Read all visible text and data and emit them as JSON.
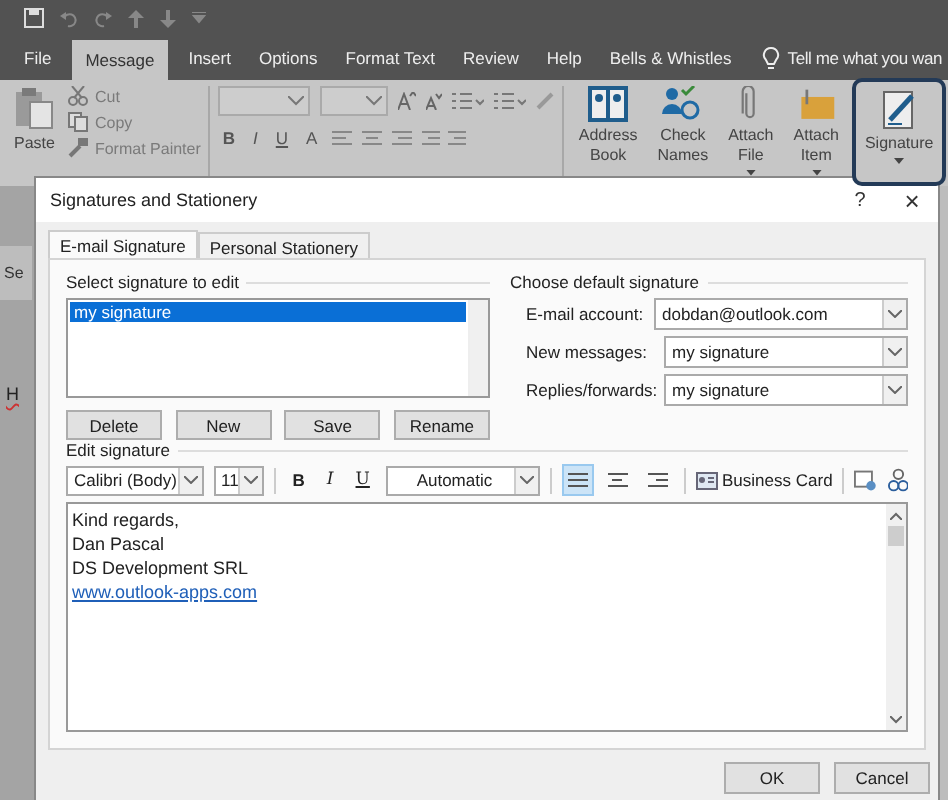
{
  "ribbon_tabs": [
    {
      "label": "File",
      "selected": false
    },
    {
      "label": "Message",
      "selected": true
    },
    {
      "label": "Insert",
      "selected": false
    },
    {
      "label": "Options",
      "selected": false
    },
    {
      "label": "Format Text",
      "selected": false
    },
    {
      "label": "Review",
      "selected": false
    },
    {
      "label": "Help",
      "selected": false
    },
    {
      "label": "Bells & Whistles",
      "selected": false
    }
  ],
  "tell_me": {
    "placeholder": "Tell me what you wan"
  },
  "clipboard": {
    "paste": "Paste",
    "small": [
      "Cut",
      "Copy",
      "Format Painter"
    ]
  },
  "basic_text": {
    "bold": "B",
    "italic": "I",
    "underline": "U",
    "font_color": "A"
  },
  "large_buttons": [
    {
      "lines": [
        "Address",
        "Book"
      ],
      "has_menu": false,
      "highlighted": false
    },
    {
      "lines": [
        "Check",
        "Names"
      ],
      "has_menu": false,
      "highlighted": false
    },
    {
      "lines": [
        "Attach",
        "File"
      ],
      "has_menu": true,
      "highlighted": false
    },
    {
      "lines": [
        "Attach",
        "Item"
      ],
      "has_menu": true,
      "highlighted": false
    },
    {
      "lines": [
        "Signature"
      ],
      "has_menu": true,
      "highlighted": true
    }
  ],
  "compose": {
    "send": "Se",
    "body": "H"
  },
  "dialog": {
    "title": "Signatures and Stationery",
    "help": "?",
    "close": "×",
    "tabs": [
      {
        "label": "E-mail Signature",
        "selected": true
      },
      {
        "label": "Personal Stationery",
        "selected": false
      }
    ],
    "select_section": {
      "title": "Select signature to edit",
      "items": [
        {
          "label": "my signature",
          "selected": true
        }
      ],
      "buttons": [
        "Delete",
        "New",
        "Save",
        "Rename"
      ]
    },
    "default_section": {
      "title": "Choose default signature",
      "fields": [
        {
          "label": "E-mail account:",
          "value": "dobdan@outlook.com"
        },
        {
          "label": "New messages:",
          "value": "my signature"
        },
        {
          "label": "Replies/forwards:",
          "value": "my signature"
        }
      ]
    },
    "editor": {
      "title": "Edit signature",
      "font": "Calibri (Body)",
      "size": "11",
      "bold": "B",
      "italic": "I",
      "underline": "U",
      "color_name": "Automatic",
      "align": [
        {
          "kind": "left",
          "selected": true
        },
        {
          "kind": "center",
          "selected": false
        },
        {
          "kind": "right",
          "selected": false
        }
      ],
      "business_card": "Business Card",
      "lines": [
        {
          "kind": "text",
          "text": "Kind regards,"
        },
        {
          "kind": "text",
          "text": "Dan Pascal"
        },
        {
          "kind": "text",
          "text": "DS Development SRL"
        },
        {
          "kind": "link",
          "text": "www.outlook-apps.com"
        }
      ]
    },
    "buttons": [
      "OK",
      "Cancel"
    ]
  }
}
